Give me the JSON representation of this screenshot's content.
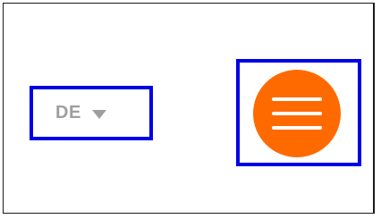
{
  "language_selector": {
    "selected": "DE",
    "caret_icon": "caret-down-icon"
  },
  "menu_button": {
    "icon": "hamburger-menu-icon",
    "color": "#ff6a00"
  },
  "highlight_color": "#0000e6"
}
